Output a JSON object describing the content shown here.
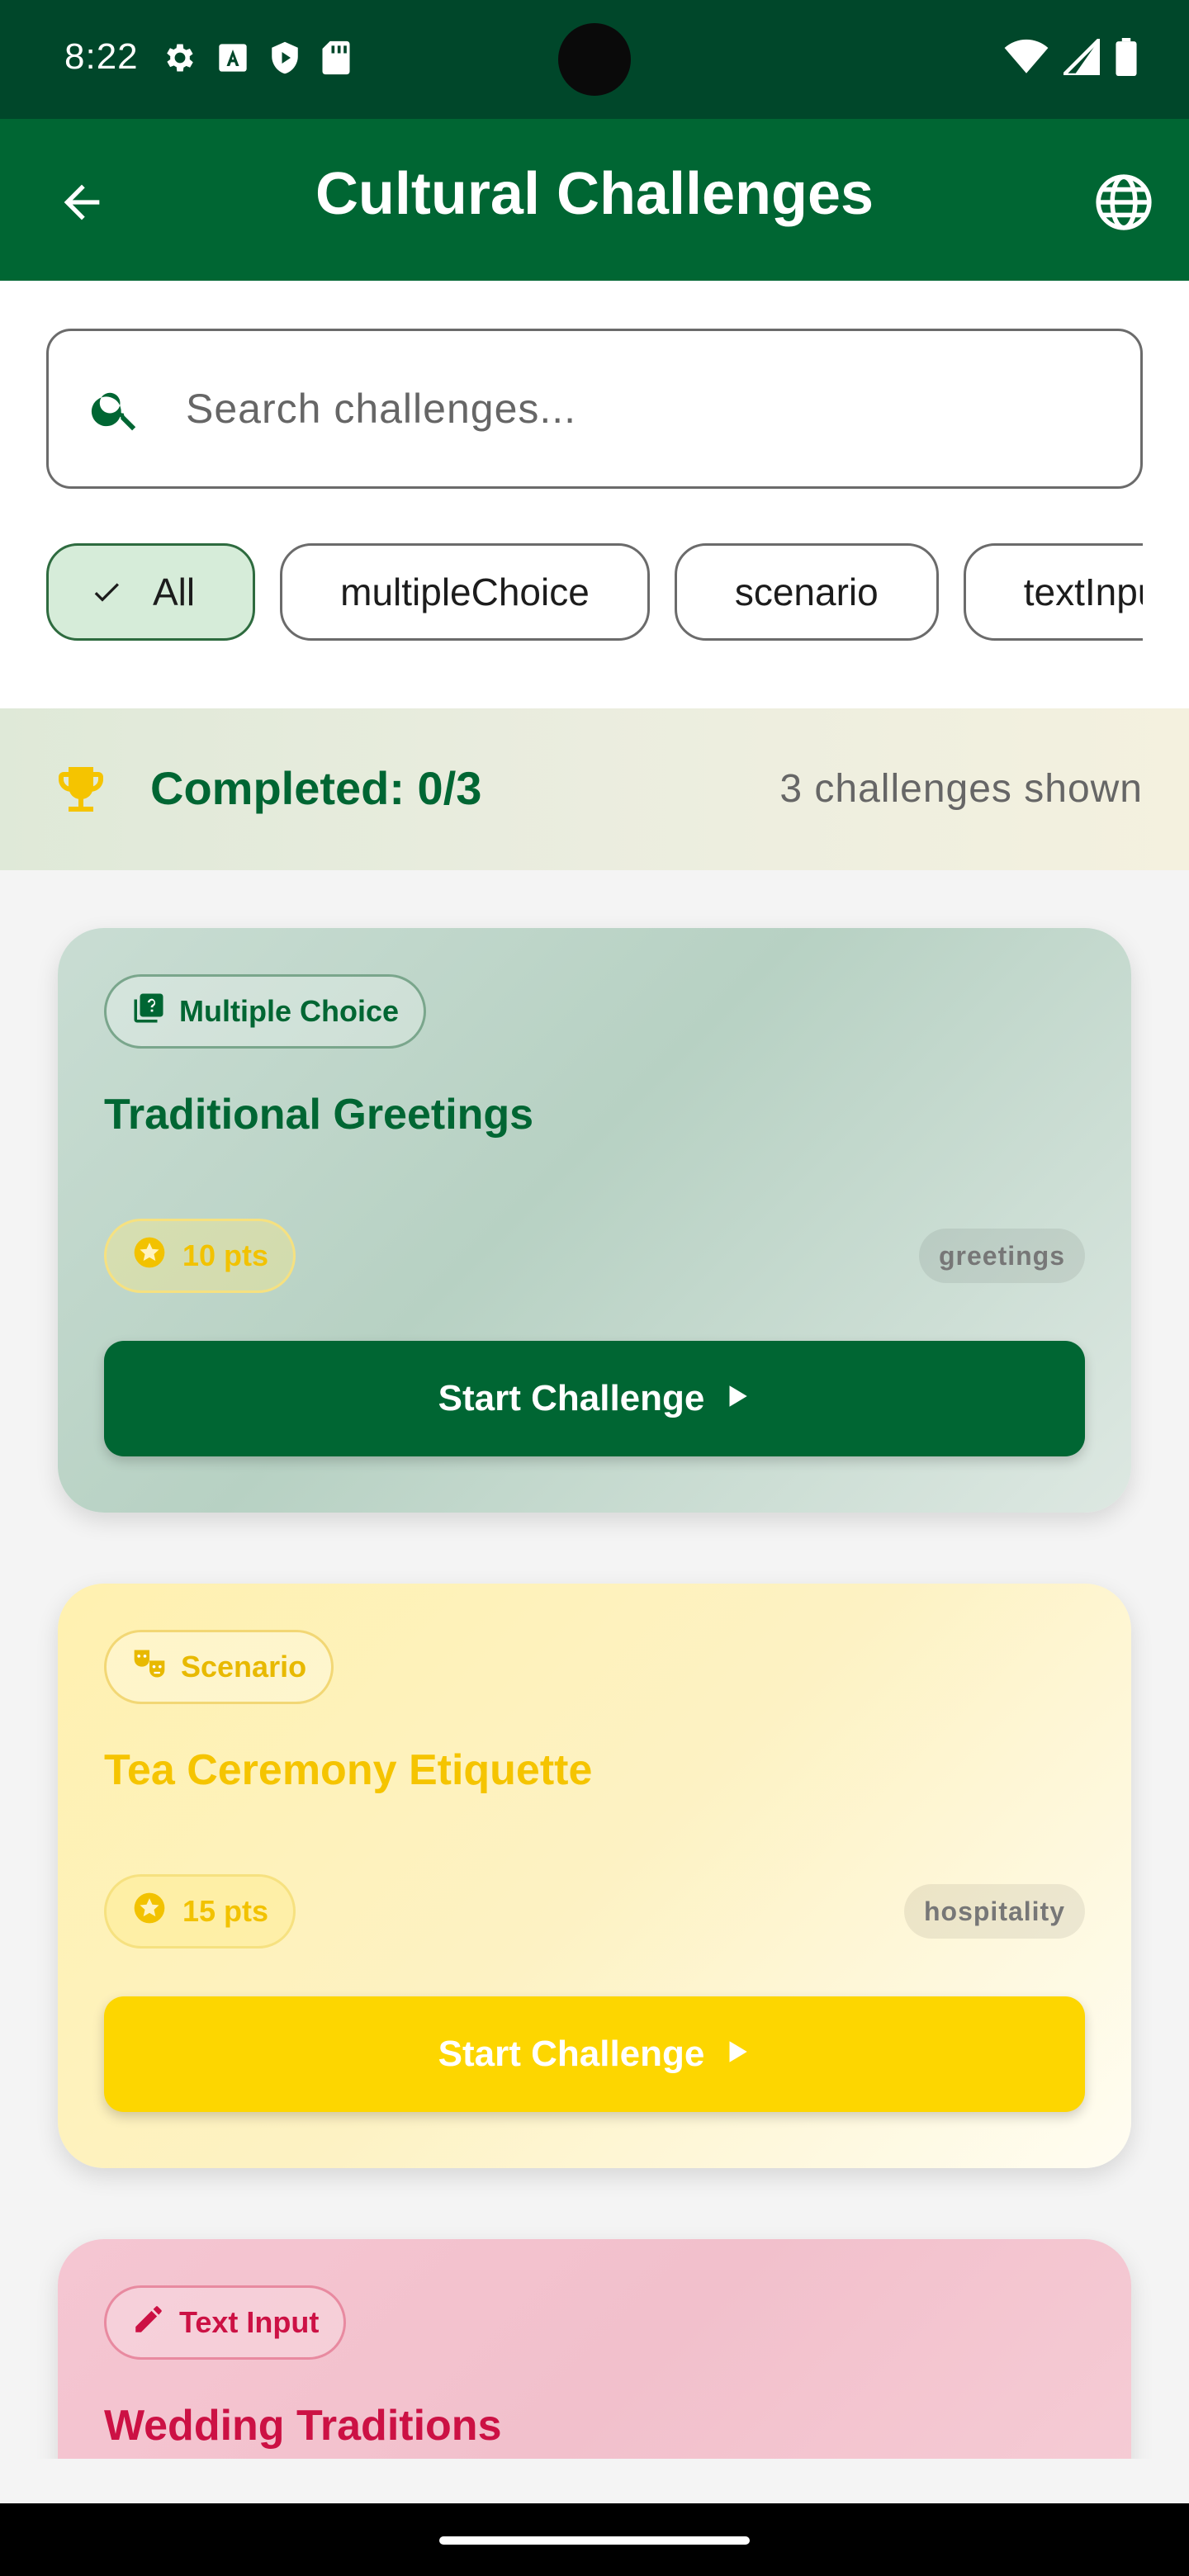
{
  "status_bar": {
    "time": "8:22",
    "left_icons": [
      "gear-icon",
      "font-download-icon",
      "shield-play-icon",
      "sd-card-icon"
    ],
    "right_icons": [
      "wifi-icon",
      "signal-icon",
      "battery-icon"
    ]
  },
  "app_bar": {
    "title": "Cultural Challenges",
    "back_icon": "arrow-left-icon",
    "action_icon": "globe-icon"
  },
  "search": {
    "placeholder": "Search challenges..."
  },
  "filters": {
    "chips": [
      {
        "label": "All",
        "selected": true
      },
      {
        "label": "multipleChoice",
        "selected": false
      },
      {
        "label": "scenario",
        "selected": false
      },
      {
        "label": "textInput",
        "selected": false
      }
    ]
  },
  "progress": {
    "completed_label": "Completed: 0/3",
    "shown_label": "3 challenges shown"
  },
  "challenges": [
    {
      "type_label": "Multiple Choice",
      "type_icon": "quiz-icon",
      "title": "Traditional Greetings",
      "points": "10 pts",
      "tag": "greetings",
      "button": "Start Challenge",
      "accent": "#006633"
    },
    {
      "type_label": "Scenario",
      "type_icon": "theater-masks-icon",
      "title": "Tea Ceremony Etiquette",
      "points": "15 pts",
      "tag": "hospitality",
      "button": "Start Challenge",
      "accent": "#fdd600"
    },
    {
      "type_label": "Text Input",
      "type_icon": "pencil-icon",
      "title": "Wedding Traditions",
      "accent": "#cc1144"
    }
  ]
}
